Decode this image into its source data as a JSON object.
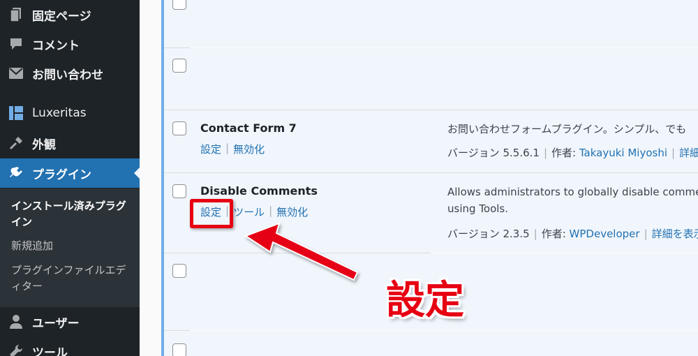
{
  "sidebar": {
    "items": [
      {
        "label": "固定ページ",
        "icon": "page-icon"
      },
      {
        "label": "コメント",
        "icon": "comment-icon"
      },
      {
        "label": "お問い合わせ",
        "icon": "mail-icon"
      },
      {
        "label": "Luxeritas",
        "icon": "luxeritas-icon"
      },
      {
        "label": "外観",
        "icon": "brush-icon"
      },
      {
        "label": "プラグイン",
        "icon": "plugin-icon"
      },
      {
        "label": "ユーザー",
        "icon": "user-icon"
      },
      {
        "label": "ツール",
        "icon": "wrench-icon"
      }
    ],
    "submenu": [
      {
        "label": "インストール済みプラグイン"
      },
      {
        "label": "新規追加"
      },
      {
        "label": "プラグインファイルエディター"
      }
    ]
  },
  "plugins": [
    {
      "name": "Contact Form 7",
      "actions": [
        "設定",
        "無効化"
      ],
      "description": "お問い合わせフォームプラグイン。シンプル、でも",
      "version_text": "バージョン 5.5.6.1",
      "author_label": "作者:",
      "author": "Takayuki Miyoshi",
      "details": "詳細を"
    },
    {
      "name": "Disable Comments",
      "actions": [
        "設定",
        "ツール",
        "無効化"
      ],
      "description_lines": [
        "Allows administrators to globally disable comment",
        "using Tools."
      ],
      "version_text": "バージョン 2.3.5",
      "author_label": "作者:",
      "author": "WPDeveloper",
      "details": "詳細を表示"
    }
  ],
  "annotation": {
    "callout": "設定",
    "color": "#e60012"
  },
  "colors": {
    "sidebar_bg": "#1d2327",
    "active_bg": "#2271b1",
    "link": "#2271b1",
    "row_bg": "#f0f6fc",
    "active_border": "#72aee6"
  }
}
